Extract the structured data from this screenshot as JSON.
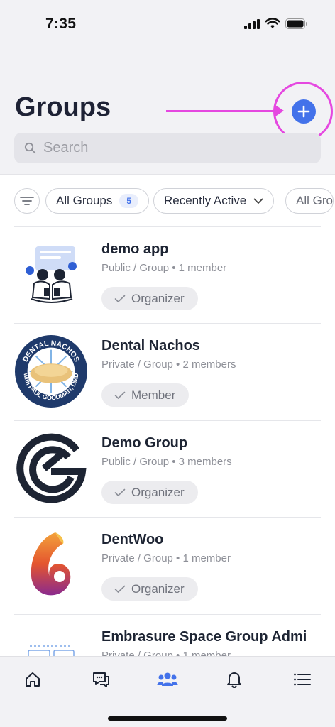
{
  "status_bar": {
    "time": "7:35"
  },
  "header": {
    "title": "Groups",
    "search_placeholder": "Search"
  },
  "filters": {
    "chips": [
      {
        "label": "All Groups",
        "count": "5"
      },
      {
        "label": "Recently Active"
      },
      {
        "label": "All Gro"
      }
    ]
  },
  "groups": [
    {
      "name": "demo app",
      "meta": "Public / Group  •  1 member",
      "role": "Organizer"
    },
    {
      "name": "Dental Nachos",
      "meta": "Private / Group  •  2 members",
      "role": "Member"
    },
    {
      "name": "Demo Group",
      "meta": "Public / Group  •  3 members",
      "role": "Organizer"
    },
    {
      "name": "DentWoo",
      "meta": "Private / Group  •  1 member",
      "role": "Organizer"
    },
    {
      "name": "Embrasure Space Group Admi",
      "meta": "Private / Group  •  1 member"
    }
  ],
  "logos": {
    "dental_nachos_top": "DENTAL NACHOS",
    "dental_nachos_bottom": "with PAUL GOODMAN, DMD"
  },
  "tab_bar": {
    "tabs": [
      {
        "icon": "home-icon"
      },
      {
        "icon": "chat-icon"
      },
      {
        "icon": "groups-icon",
        "active": true
      },
      {
        "icon": "bell-icon"
      },
      {
        "icon": "menu-icon"
      }
    ]
  },
  "colors": {
    "accent": "#4372ea",
    "annotation": "#e548e0"
  }
}
